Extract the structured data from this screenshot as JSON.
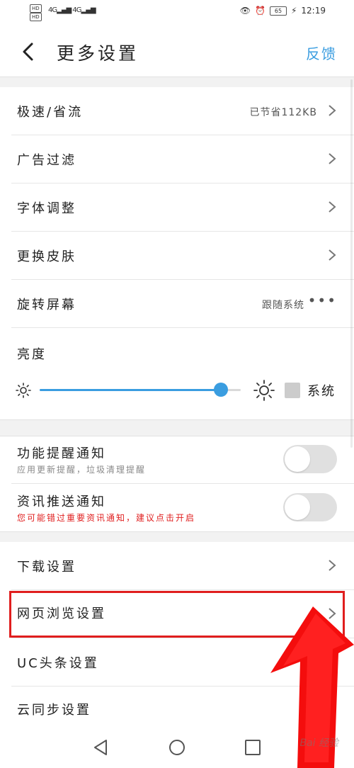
{
  "status_bar": {
    "hd1": "HD",
    "hd2": "HD",
    "net1": "4G",
    "net2": "4G",
    "battery": "65",
    "time": "12:19"
  },
  "header": {
    "title": "更多设置",
    "feedback": "反馈"
  },
  "rows": {
    "speed": {
      "label": "极速/省流",
      "value": "已节省112KB"
    },
    "adfilter": {
      "label": "广告过滤"
    },
    "font": {
      "label": "字体调整"
    },
    "skin": {
      "label": "更换皮肤"
    },
    "rotate": {
      "label": "旋转屏幕",
      "value": "跟随系统"
    },
    "brightness": {
      "label": "亮度",
      "system_label": "系统",
      "level": 0.9
    },
    "func_notify": {
      "label": "功能提醒通知",
      "sub": "应用更新提醒，垃圾清理提醒",
      "on": false
    },
    "news_notify": {
      "label": "资讯推送通知",
      "sub": "您可能错过重要资讯通知，建议点击开启",
      "on": false
    },
    "download": {
      "label": "下载设置"
    },
    "browse": {
      "label": "网页浏览设置"
    },
    "ucnews": {
      "label": "UC头条设置"
    },
    "cloud": {
      "label": "云同步设置"
    }
  },
  "colors": {
    "accent": "#3a9de0",
    "highlight": "#e01e1e",
    "warning": "#e02020"
  },
  "watermark": "Bai 经验"
}
